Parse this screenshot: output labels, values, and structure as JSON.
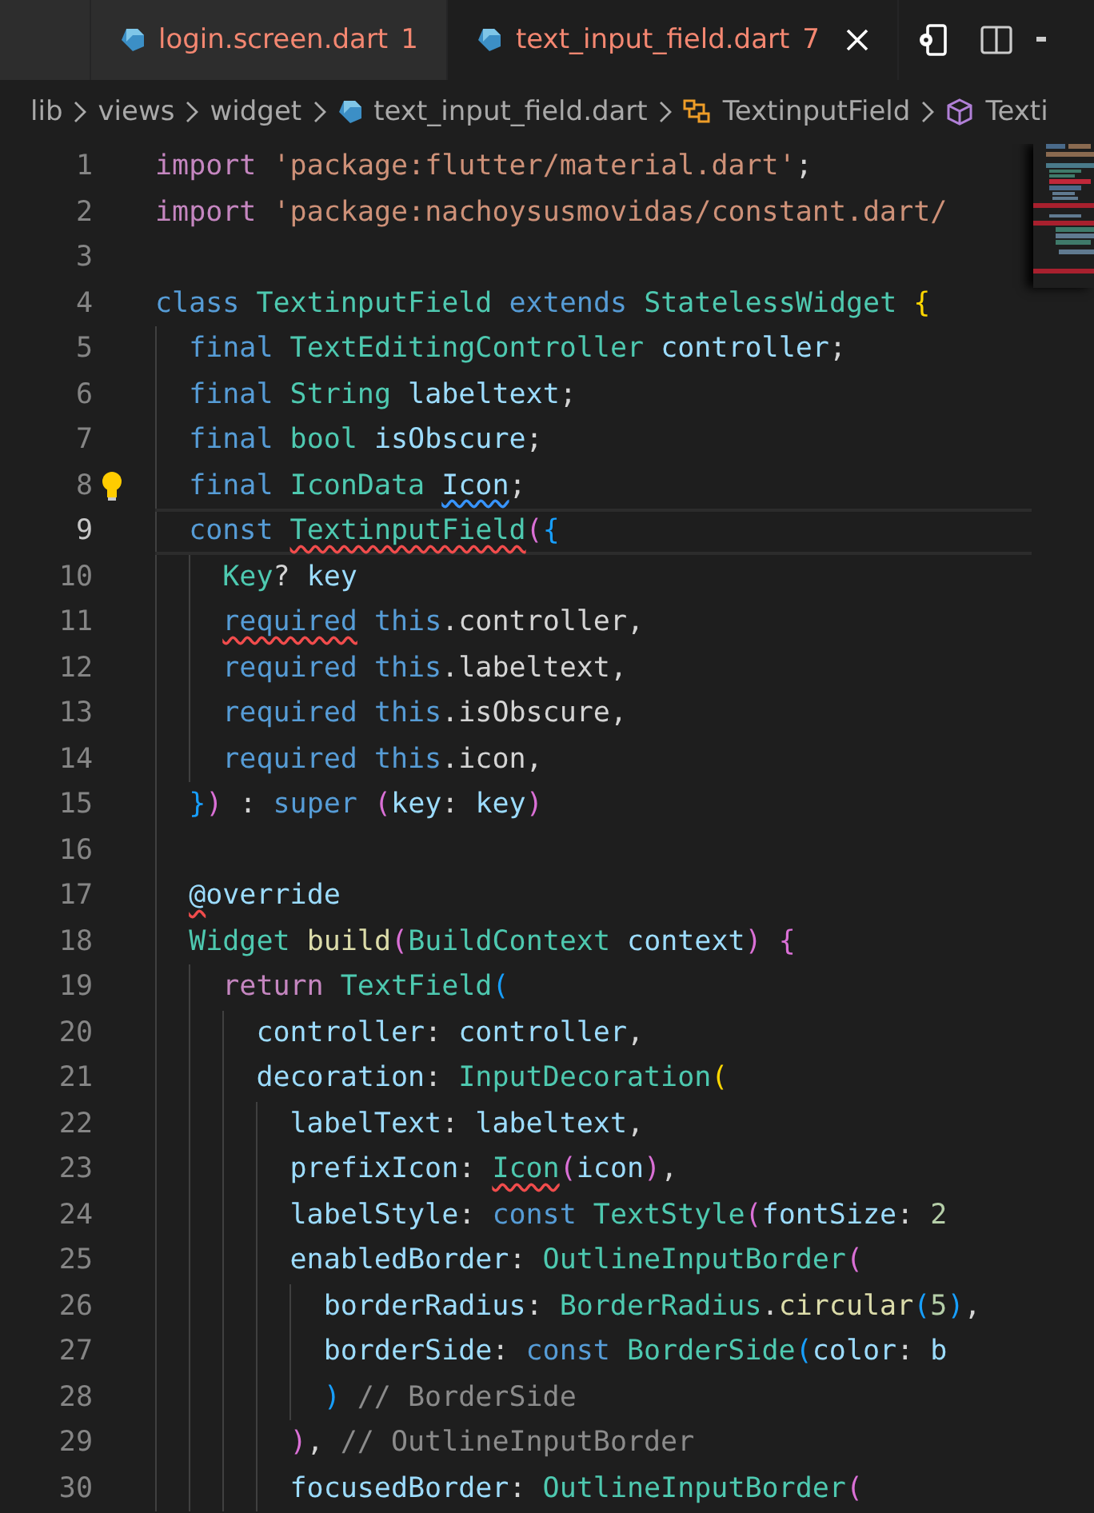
{
  "tabs": [
    {
      "label": "login.screen.dart",
      "badge": "1",
      "selected": false
    },
    {
      "label": "text_input_field.dart",
      "badge": "7",
      "selected": true
    }
  ],
  "breadcrumb": [
    {
      "kind": "folder",
      "label": "lib"
    },
    {
      "kind": "folder",
      "label": "views"
    },
    {
      "kind": "folder",
      "label": "widget"
    },
    {
      "kind": "file",
      "label": "text_input_field.dart"
    },
    {
      "kind": "class",
      "label": "TextinputField"
    },
    {
      "kind": "method",
      "label": "Texti"
    }
  ],
  "lines": [
    {
      "n": "1",
      "current": false,
      "tokens": [
        {
          "kind": "ctrl",
          "text": "import "
        },
        {
          "kind": "str",
          "text": "'package:flutter/material.dart'"
        },
        {
          "kind": "plain",
          "text": ";"
        }
      ]
    },
    {
      "n": "2",
      "current": false,
      "tokens": [
        {
          "kind": "ctrl",
          "text": "import "
        },
        {
          "kind": "str",
          "text": "'package:nachoysusmovidas/constant.dart/"
        }
      ]
    },
    {
      "n": "3",
      "current": false
    },
    {
      "n": "4",
      "current": false,
      "tokens": [
        {
          "kind": "kw",
          "text": "class "
        },
        {
          "kind": "type",
          "text": "TextinputField "
        },
        {
          "kind": "kw",
          "text": "extends "
        },
        {
          "kind": "type",
          "text": "StatelessWidget "
        },
        {
          "kind": "b1",
          "text": "{"
        }
      ],
      "children": [
        {
          "n": "5",
          "current": false,
          "tokens": [
            {
              "kind": "kw",
              "text": "final "
            },
            {
              "kind": "type",
              "text": "TextEditingController "
            },
            {
              "kind": "var",
              "text": "controller"
            },
            {
              "kind": "plain",
              "text": ";"
            }
          ]
        },
        {
          "n": "6",
          "current": false,
          "tokens": [
            {
              "kind": "kw",
              "text": "final "
            },
            {
              "kind": "type",
              "text": "String "
            },
            {
              "kind": "var",
              "text": "labeltext"
            },
            {
              "kind": "plain",
              "text": ";"
            }
          ]
        },
        {
          "n": "7",
          "current": false,
          "tokens": [
            {
              "kind": "kw",
              "text": "final "
            },
            {
              "kind": "type",
              "text": "bool "
            },
            {
              "kind": "var",
              "text": "isObscure"
            },
            {
              "kind": "plain",
              "text": ";"
            }
          ]
        },
        {
          "n": "8",
          "current": false,
          "bulb": true,
          "tokens": [
            {
              "kind": "kw",
              "text": "final "
            },
            {
              "kind": "type",
              "text": "IconData "
            },
            {
              "kind": "var",
              "text": "Icon",
              "info_squiggle": true
            },
            {
              "kind": "plain",
              "text": ";"
            }
          ]
        },
        {
          "n": "9",
          "current": true,
          "tokens": [
            {
              "kind": "kw",
              "text": "const "
            },
            {
              "kind": "type",
              "text": "TextinputField",
              "error_squiggle": true
            },
            {
              "kind": "b2",
              "text": "("
            },
            {
              "kind": "b3",
              "text": "{"
            }
          ],
          "children": [
            {
              "n": "10",
              "current": false,
              "tokens": [
                {
                  "kind": "type",
                  "text": "Key"
                },
                {
                  "kind": "plain",
                  "text": "? "
                },
                {
                  "kind": "var",
                  "text": "key"
                }
              ]
            },
            {
              "n": "11",
              "current": false,
              "tokens": [
                {
                  "kind": "kw",
                  "text": "required",
                  "error_squiggle": true
                },
                {
                  "kind": "kw",
                  "text": " this"
                },
                {
                  "kind": "plain",
                  "text": ".controller,"
                }
              ]
            },
            {
              "n": "12",
              "current": false,
              "tokens": [
                {
                  "kind": "kw",
                  "text": "required this"
                },
                {
                  "kind": "plain",
                  "text": ".labeltext,"
                }
              ]
            },
            {
              "n": "13",
              "current": false,
              "tokens": [
                {
                  "kind": "kw",
                  "text": "required this"
                },
                {
                  "kind": "plain",
                  "text": ".isObscure,"
                }
              ]
            },
            {
              "n": "14",
              "current": false,
              "tokens": [
                {
                  "kind": "kw",
                  "text": "required this"
                },
                {
                  "kind": "plain",
                  "text": ".icon,"
                }
              ]
            }
          ]
        },
        {
          "n": "15",
          "current": false,
          "tokens": [
            {
              "kind": "b3",
              "text": "}"
            },
            {
              "kind": "b2",
              "text": ") "
            },
            {
              "kind": "plain",
              "text": ": "
            },
            {
              "kind": "kw",
              "text": "super "
            },
            {
              "kind": "b2",
              "text": "("
            },
            {
              "kind": "var",
              "text": "key"
            },
            {
              "kind": "plain",
              "text": ": "
            },
            {
              "kind": "var",
              "text": "key"
            },
            {
              "kind": "b2",
              "text": ")"
            }
          ]
        },
        {
          "n": "16",
          "current": false
        },
        {
          "n": "17",
          "current": false,
          "tokens": [
            {
              "kind": "var",
              "text": "@",
              "error_squiggle": true
            },
            {
              "kind": "var",
              "text": "override"
            }
          ]
        },
        {
          "n": "18",
          "current": false,
          "tokens": [
            {
              "kind": "type",
              "text": "Widget "
            },
            {
              "kind": "func",
              "text": "build"
            },
            {
              "kind": "b2",
              "text": "("
            },
            {
              "kind": "type",
              "text": "BuildContext "
            },
            {
              "kind": "var",
              "text": "context"
            },
            {
              "kind": "b2",
              "text": ") {"
            }
          ],
          "children": [
            {
              "n": "19",
              "current": false,
              "tokens": [
                {
                  "kind": "ctrl",
                  "text": "return "
                },
                {
                  "kind": "type",
                  "text": "TextField"
                },
                {
                  "kind": "b3",
                  "text": "("
                }
              ],
              "children": [
                {
                  "n": "20",
                  "current": false,
                  "tokens": [
                    {
                      "kind": "var",
                      "text": "controller"
                    },
                    {
                      "kind": "plain",
                      "text": ": "
                    },
                    {
                      "kind": "var",
                      "text": "controller"
                    },
                    {
                      "kind": "plain",
                      "text": ","
                    }
                  ]
                },
                {
                  "n": "21",
                  "current": false,
                  "tokens": [
                    {
                      "kind": "var",
                      "text": "decoration"
                    },
                    {
                      "kind": "plain",
                      "text": ": "
                    },
                    {
                      "kind": "type",
                      "text": "InputDecoration"
                    },
                    {
                      "kind": "b1",
                      "text": "("
                    }
                  ],
                  "children": [
                    {
                      "n": "22",
                      "current": false,
                      "tokens": [
                        {
                          "kind": "var",
                          "text": "labelText"
                        },
                        {
                          "kind": "plain",
                          "text": ": "
                        },
                        {
                          "kind": "var",
                          "text": "labeltext"
                        },
                        {
                          "kind": "plain",
                          "text": ","
                        }
                      ]
                    },
                    {
                      "n": "23",
                      "current": false,
                      "tokens": [
                        {
                          "kind": "var",
                          "text": "prefixIcon"
                        },
                        {
                          "kind": "plain",
                          "text": ": "
                        },
                        {
                          "kind": "type",
                          "text": "Icon",
                          "error_squiggle": true
                        },
                        {
                          "kind": "b2",
                          "text": "("
                        },
                        {
                          "kind": "var",
                          "text": "icon"
                        },
                        {
                          "kind": "b2",
                          "text": ")"
                        },
                        {
                          "kind": "plain",
                          "text": ","
                        }
                      ]
                    },
                    {
                      "n": "24",
                      "current": false,
                      "tokens": [
                        {
                          "kind": "var",
                          "text": "labelStyle"
                        },
                        {
                          "kind": "plain",
                          "text": ": "
                        },
                        {
                          "kind": "kw",
                          "text": "const "
                        },
                        {
                          "kind": "type",
                          "text": "TextStyle"
                        },
                        {
                          "kind": "b2",
                          "text": "("
                        },
                        {
                          "kind": "var",
                          "text": "fontSize"
                        },
                        {
                          "kind": "plain",
                          "text": ": "
                        },
                        {
                          "kind": "num",
                          "text": "2"
                        }
                      ]
                    },
                    {
                      "n": "25",
                      "current": false,
                      "tokens": [
                        {
                          "kind": "var",
                          "text": "enabledBorder"
                        },
                        {
                          "kind": "plain",
                          "text": ": "
                        },
                        {
                          "kind": "type",
                          "text": "OutlineInputBorder"
                        },
                        {
                          "kind": "b2",
                          "text": "("
                        }
                      ],
                      "children": [
                        {
                          "n": "26",
                          "current": false,
                          "tokens": [
                            {
                              "kind": "var",
                              "text": "borderRadius"
                            },
                            {
                              "kind": "plain",
                              "text": ": "
                            },
                            {
                              "kind": "type",
                              "text": "BorderRadius"
                            },
                            {
                              "kind": "plain",
                              "text": "."
                            },
                            {
                              "kind": "func",
                              "text": "circular"
                            },
                            {
                              "kind": "b3",
                              "text": "("
                            },
                            {
                              "kind": "num",
                              "text": "5"
                            },
                            {
                              "kind": "b3",
                              "text": ")"
                            },
                            {
                              "kind": "plain",
                              "text": ","
                            }
                          ]
                        },
                        {
                          "n": "27",
                          "current": false,
                          "tokens": [
                            {
                              "kind": "var",
                              "text": "borderSide"
                            },
                            {
                              "kind": "plain",
                              "text": ": "
                            },
                            {
                              "kind": "kw",
                              "text": "const "
                            },
                            {
                              "kind": "type",
                              "text": "BorderSide"
                            },
                            {
                              "kind": "b3",
                              "text": "("
                            },
                            {
                              "kind": "var",
                              "text": "color"
                            },
                            {
                              "kind": "plain",
                              "text": ": "
                            },
                            {
                              "kind": "var",
                              "text": "b"
                            }
                          ]
                        },
                        {
                          "n": "28",
                          "current": false,
                          "tokens": [
                            {
                              "kind": "b3",
                              "text": ") "
                            },
                            {
                              "kind": "comment",
                              "text": "// BorderSide"
                            }
                          ]
                        }
                      ]
                    },
                    {
                      "n": "29",
                      "current": false,
                      "tokens": [
                        {
                          "kind": "b2",
                          "text": ")"
                        },
                        {
                          "kind": "plain",
                          "text": ", "
                        },
                        {
                          "kind": "comment",
                          "text": "// OutlineInputBorder"
                        }
                      ]
                    },
                    {
                      "n": "30",
                      "current": false,
                      "tokens": [
                        {
                          "kind": "var",
                          "text": "focusedBorder"
                        },
                        {
                          "kind": "plain",
                          "text": ": "
                        },
                        {
                          "kind": "type",
                          "text": "OutlineInputBorder"
                        },
                        {
                          "kind": "b2",
                          "text": "("
                        }
                      ]
                    }
                  ]
                }
              ]
            }
          ]
        }
      ]
    }
  ]
}
